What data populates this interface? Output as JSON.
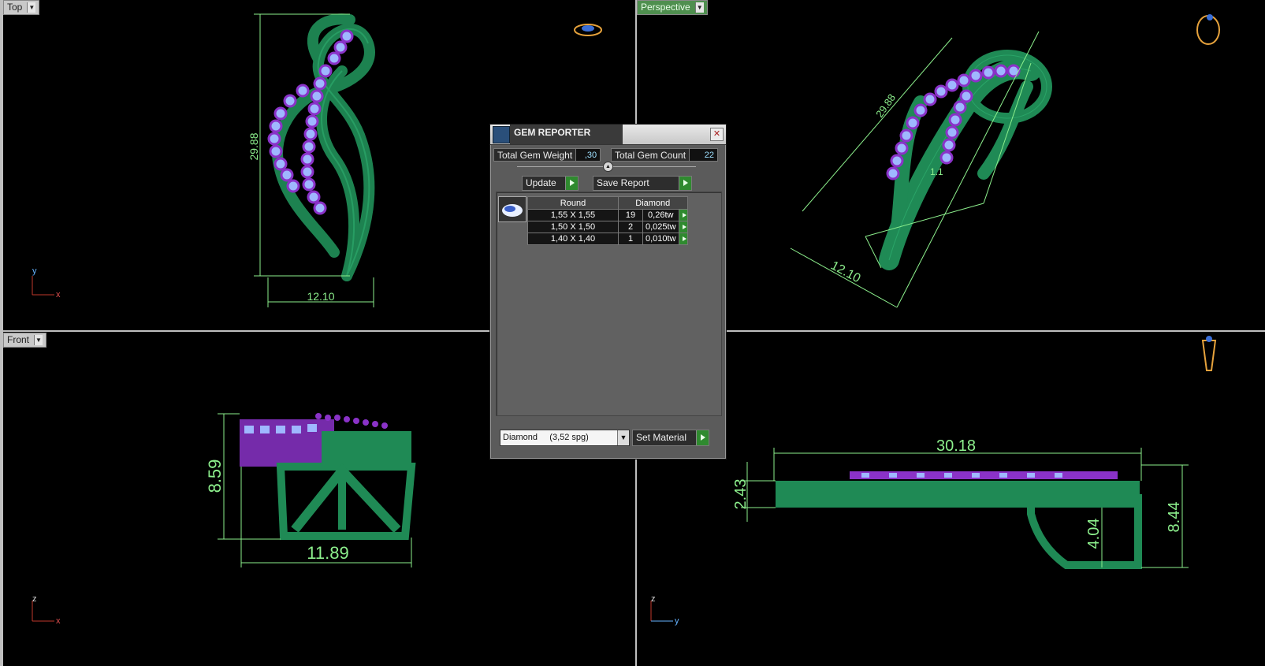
{
  "viewports": {
    "top": {
      "label": "Top",
      "axis_v": "y",
      "axis_h": "x",
      "dims": [
        "29.88",
        "12.10"
      ]
    },
    "perspective": {
      "label": "Perspective",
      "dims": [
        "29.88",
        "12.10",
        "1.1"
      ]
    },
    "front": {
      "label": "Front",
      "axis_v": "z",
      "axis_h": "x",
      "dims": [
        "8.59",
        "11.89"
      ]
    },
    "right": {
      "axis_v": "z",
      "axis_h": "y",
      "dims": [
        "30.18",
        "2.43",
        "4.04",
        "8.44"
      ]
    }
  },
  "gem_reporter": {
    "title": "GEM REPORTER",
    "total_weight_label": "Total Gem Weight",
    "total_weight_value": ",30",
    "total_count_label": "Total Gem Count",
    "total_count_value": "22",
    "update_label": "Update",
    "save_report_label": "Save Report",
    "table": {
      "headers": [
        "Round",
        "Diamond"
      ],
      "rows": [
        {
          "size": "1,55 X 1,55",
          "count": "19",
          "weight": "0,26tw"
        },
        {
          "size": "1,50 X 1,50",
          "count": "2",
          "weight": "0,025tw"
        },
        {
          "size": "1,40 X 1,40",
          "count": "1",
          "weight": "0,010tw"
        }
      ]
    },
    "material_value": "Diamond     (3,52 spg)",
    "set_material_label": "Set Material"
  },
  "colors": {
    "model": "#1f8a55",
    "gems": "#9fb7ff",
    "prongs": "#8a32c8",
    "dims": "#8df08d",
    "active_viewport": "#4f8f4f"
  }
}
